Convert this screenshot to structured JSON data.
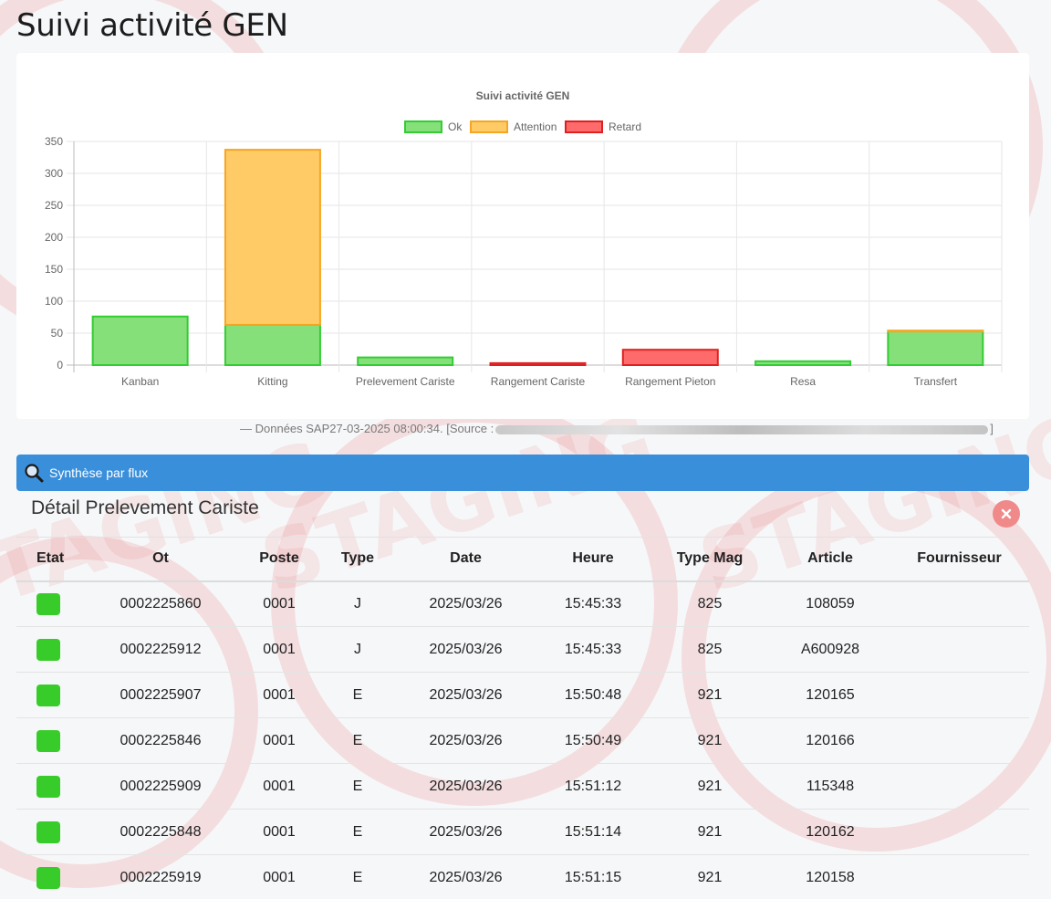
{
  "page": {
    "title": "Suivi activité GEN"
  },
  "colors": {
    "ok_fill": "#86e07a",
    "ok_border": "#33cc33",
    "attention_fill": "#ffcb66",
    "attention_border": "#f5a623",
    "retard_fill": "#ff6b6b",
    "retard_border": "#e02020",
    "accent": "#3a8fdb",
    "status_ok": "#38cc2a"
  },
  "chart_data": {
    "type": "bar",
    "stacked": true,
    "title": "Suivi activité GEN",
    "legend_position": "top",
    "grid": true,
    "ylim": [
      0,
      350
    ],
    "y_ticks": [
      0,
      50,
      100,
      150,
      200,
      250,
      300,
      350
    ],
    "categories": [
      "Kanban",
      "Kitting",
      "Prelevement Cariste",
      "Rangement Cariste",
      "Rangement Pieton",
      "Resa",
      "Transfert"
    ],
    "series": [
      {
        "name": "Ok",
        "values": [
          76,
          63,
          12,
          0,
          0,
          6,
          53
        ]
      },
      {
        "name": "Attention",
        "values": [
          0,
          274,
          0,
          0,
          0,
          0,
          1
        ]
      },
      {
        "name": "Retard",
        "values": [
          0,
          0,
          0,
          3,
          24,
          0,
          0
        ]
      }
    ]
  },
  "source": {
    "text": "— Données SAP27-03-2025 08:00:34. [Source :",
    "end": "]"
  },
  "flux_bar": {
    "label": "Synthèse par flux",
    "icon": "search-icon"
  },
  "detail": {
    "title": "Détail Prelevement Cariste",
    "close_icon": "close-icon",
    "columns": [
      "Etat",
      "Ot",
      "Poste",
      "Type",
      "Date",
      "Heure",
      "Type Mag",
      "Article",
      "Fournisseur"
    ],
    "rows": [
      {
        "ot": "0002225860",
        "poste": "0001",
        "type": "J",
        "date": "2025/03/26",
        "heure": "15:45:33",
        "mag": "825",
        "article": "108059",
        "fournisseur": ""
      },
      {
        "ot": "0002225912",
        "poste": "0001",
        "type": "J",
        "date": "2025/03/26",
        "heure": "15:45:33",
        "mag": "825",
        "article": "A600928",
        "fournisseur": ""
      },
      {
        "ot": "0002225907",
        "poste": "0001",
        "type": "E",
        "date": "2025/03/26",
        "heure": "15:50:48",
        "mag": "921",
        "article": "120165",
        "fournisseur": ""
      },
      {
        "ot": "0002225846",
        "poste": "0001",
        "type": "E",
        "date": "2025/03/26",
        "heure": "15:50:49",
        "mag": "921",
        "article": "120166",
        "fournisseur": ""
      },
      {
        "ot": "0002225909",
        "poste": "0001",
        "type": "E",
        "date": "2025/03/26",
        "heure": "15:51:12",
        "mag": "921",
        "article": "115348",
        "fournisseur": ""
      },
      {
        "ot": "0002225848",
        "poste": "0001",
        "type": "E",
        "date": "2025/03/26",
        "heure": "15:51:14",
        "mag": "921",
        "article": "120162",
        "fournisseur": ""
      },
      {
        "ot": "0002225919",
        "poste": "0001",
        "type": "E",
        "date": "2025/03/26",
        "heure": "15:51:15",
        "mag": "921",
        "article": "120158",
        "fournisseur": ""
      }
    ]
  }
}
